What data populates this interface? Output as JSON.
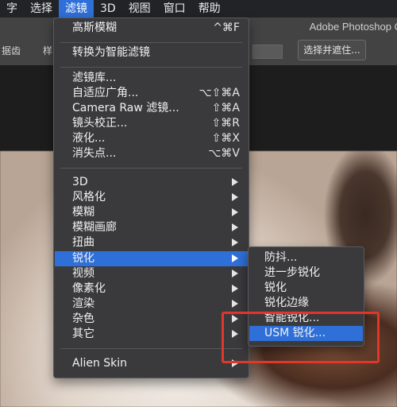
{
  "menubar": {
    "items": [
      "字",
      "选择",
      "滤镜",
      "3D",
      "视图",
      "窗口",
      "帮助"
    ],
    "active": "滤镜"
  },
  "app": {
    "title": "Adobe Photoshop C",
    "options_label_left": "据齿",
    "options_label_second": "样",
    "options_button": "选择并遮住..."
  },
  "filter_menu": {
    "items": [
      {
        "label": "高斯模糊",
        "shortcut": "^⌘F"
      },
      {
        "label": "转换为智能滤镜",
        "shortcut": ""
      },
      {
        "label": "滤镜库...",
        "shortcut": ""
      },
      {
        "label": "自适应广角...",
        "shortcut": "⌥⇧⌘A"
      },
      {
        "label": "Camera Raw 滤镜...",
        "shortcut": "⇧⌘A"
      },
      {
        "label": "镜头校正...",
        "shortcut": "⇧⌘R"
      },
      {
        "label": "液化...",
        "shortcut": "⇧⌘X"
      },
      {
        "label": "消失点...",
        "shortcut": "⌥⌘V"
      },
      {
        "label": "3D",
        "shortcut": ""
      },
      {
        "label": "风格化",
        "shortcut": ""
      },
      {
        "label": "模糊",
        "shortcut": ""
      },
      {
        "label": "模糊画廊",
        "shortcut": ""
      },
      {
        "label": "扭曲",
        "shortcut": ""
      },
      {
        "label": "锐化",
        "shortcut": ""
      },
      {
        "label": "视频",
        "shortcut": ""
      },
      {
        "label": "像素化",
        "shortcut": ""
      },
      {
        "label": "渲染",
        "shortcut": ""
      },
      {
        "label": "杂色",
        "shortcut": ""
      },
      {
        "label": "其它",
        "shortcut": ""
      },
      {
        "label": "Alien Skin",
        "shortcut": ""
      }
    ]
  },
  "sharpen_submenu": {
    "items": [
      {
        "label": "防抖..."
      },
      {
        "label": "进一步锐化"
      },
      {
        "label": "锐化"
      },
      {
        "label": "锐化边缘"
      },
      {
        "label": "智能锐化..."
      },
      {
        "label": "USM 锐化..."
      }
    ],
    "highlighted": "USM 锐化..."
  },
  "colors": {
    "highlight": "#2f6fd8",
    "menu_bg": "#3a3a3d",
    "red_box": "#e2362b"
  }
}
